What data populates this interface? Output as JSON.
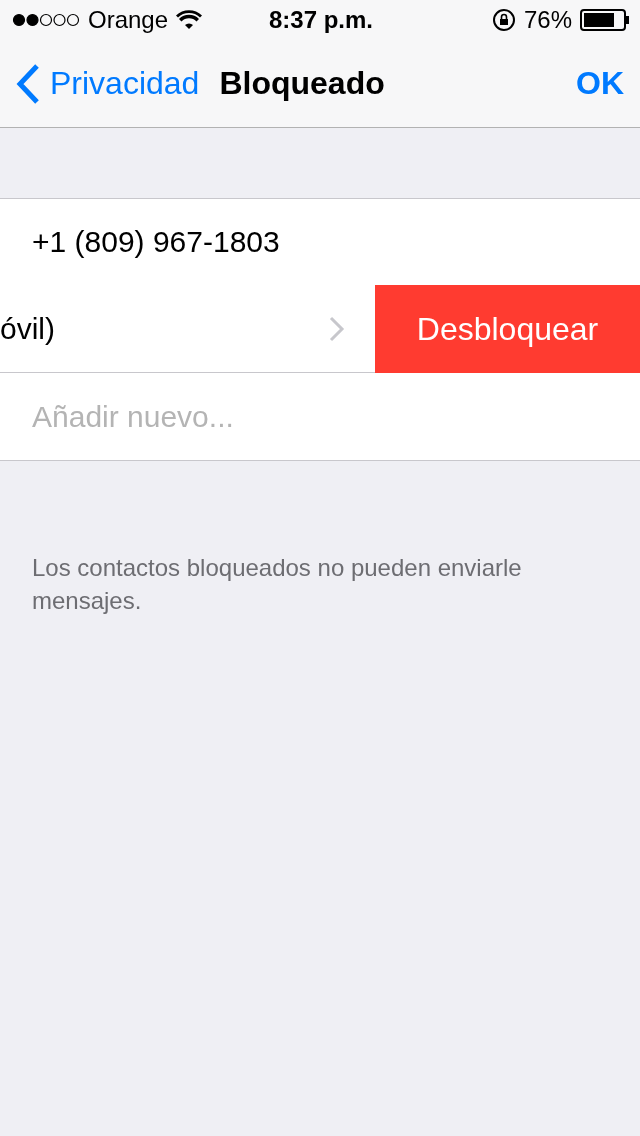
{
  "status_bar": {
    "carrier": "Orange",
    "time": "8:37 p.m.",
    "battery": "76%"
  },
  "nav": {
    "back": "Privacidad",
    "title": "Bloqueado",
    "action": "OK"
  },
  "blocked": [
    {
      "line_1": "+1 (809) 967-1803",
      "line_2": "óvil)",
      "action": "Desbloquear"
    }
  ],
  "add_new": "Añadir nuevo...",
  "footer": "Los contactos bloqueados no pueden enviarle mensajes."
}
